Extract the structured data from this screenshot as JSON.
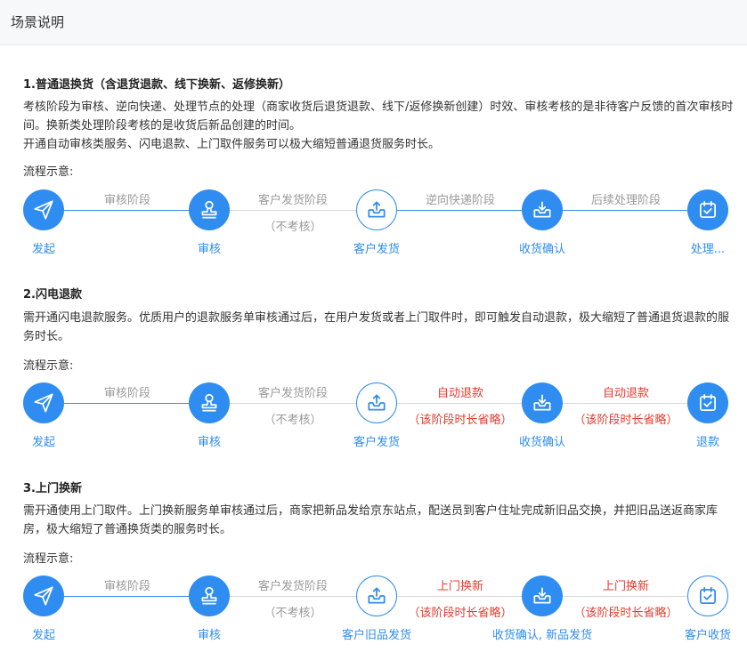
{
  "header": {
    "title": "场景说明"
  },
  "flow_label": "流程示意:",
  "sections": [
    {
      "title": "1.普通退换货（含退货退款、线下换新、返修换新）",
      "desc": [
        "考核阶段为审核、逆向快递、处理节点的处理（商家收货后退货退款、线下/返修换新创建）时效、审核考核的是非待客户反馈的首次审核时间。换新类处理阶段考核的是收货后新品创建的时间。",
        "开通自动审核类服务、闪电退款、上门取件服务可以极大缩短普通退货服务时长。"
      ],
      "nodes": [
        "发起",
        "审核",
        "客户发货",
        "收货确认",
        "处理..."
      ],
      "stages": [
        {
          "line1": "审核阶段",
          "line2": ""
        },
        {
          "line1": "客户发货阶段",
          "line2": "（不考核）"
        },
        {
          "line1": "逆向快递阶段",
          "line2": ""
        },
        {
          "line1": "后续处理阶段",
          "line2": ""
        }
      ]
    },
    {
      "title": "2.闪电退款",
      "desc": [
        "需开通闪电退款服务。优质用户的退款服务单审核通过后，在用户发货或者上门取件时，即可触发自动退款，极大缩短了普通退货退款的服务时长。"
      ],
      "nodes": [
        "发起",
        "审核",
        "客户发货",
        "收货确认",
        "退款"
      ],
      "stages": [
        {
          "line1": "审核阶段",
          "line2": ""
        },
        {
          "line1": "客户发货阶段",
          "line2": "（不考核）"
        },
        {
          "line1": "自动退款",
          "line2": "（该阶段时长省略）"
        },
        {
          "line1": "自动退款",
          "line2": "（该阶段时长省略）"
        }
      ]
    },
    {
      "title": "3.上门换新",
      "desc": [
        "需开通使用上门取件。上门换新服务单审核通过后，商家把新品发给京东站点，配送员到客户住址完成新旧品交换，并把旧品送返商家库房，极大缩短了普通换货类的服务时长。"
      ],
      "nodes": [
        "发起",
        "审核",
        "客户旧品发货",
        "收货确认, 新品发货",
        "客户收货"
      ],
      "stages": [
        {
          "line1": "审核阶段",
          "line2": ""
        },
        {
          "line1": "客户发货阶段",
          "line2": "（不考核）"
        },
        {
          "line1": "上门换新",
          "line2": "（该阶段时长省略）"
        },
        {
          "line1": "上门换新",
          "line2": "（该阶段时长省略）"
        }
      ]
    }
  ],
  "icons": [
    "send-icon",
    "stamp-icon",
    "tray-upload-icon",
    "tray-download-icon",
    "calendar-check-icon"
  ],
  "colors": {
    "accent": "#2f8cf0",
    "gray_text": "#999999",
    "red_text": "#e63b2e",
    "line_gray": "#d9d9d9"
  }
}
